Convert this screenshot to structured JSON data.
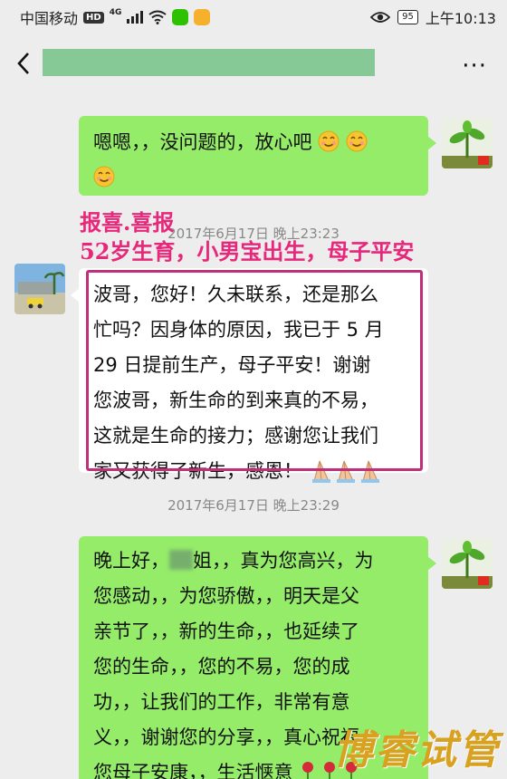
{
  "status_bar": {
    "carrier": "中国移动",
    "hd_badge": "HD",
    "network_type": "4G",
    "battery": "95",
    "time": "上午10:13"
  },
  "nav": {
    "back_icon": "chevron-left-icon",
    "more_icon": "more-dots-icon",
    "more_label": "···"
  },
  "messages": [
    {
      "sender": "me",
      "lines": [
        "嗯嗯，，没问题的，放心吧",
        ""
      ]
    },
    {
      "timestamp": "2017年6月17日 晚上23:23"
    },
    {
      "sender": "other",
      "lines": [
        "波哥，您好！久未联系，还是那么",
        "忙吗？因身体的原因，我已于 5 月",
        "29 日提前生产，母子平安！谢谢",
        "您波哥，新生命的到来真的不易，",
        "这就是生命的接力；感谢您让我们",
        "家又获得了新生，感恩！"
      ]
    },
    {
      "timestamp": "2017年6月17日 晚上23:29"
    },
    {
      "sender": "me",
      "lines_first_prefix": "晚上好，",
      "lines_first_suffix": "姐，，真为您高兴，为",
      "lines": [
        "您感动，，为您骄傲，，明天是父",
        "亲节了，，新的生命，，也延续了",
        "您的生命，，您的不易，您的成",
        "功，，让我们的工作，非常有意",
        "义，，谢谢您的分享，，真心祝福",
        "您母子安康，，生活惬意"
      ]
    }
  ],
  "overlay": {
    "line1": "报喜.喜报",
    "line2": "52岁生育，小男宝出生，母子平安"
  },
  "watermark": "博睿试管",
  "colors": {
    "my_bubble": "#95ec69",
    "their_bubble": "#ffffff",
    "overlay_text": "#e8267a",
    "highlight_border": "#c0307a"
  }
}
